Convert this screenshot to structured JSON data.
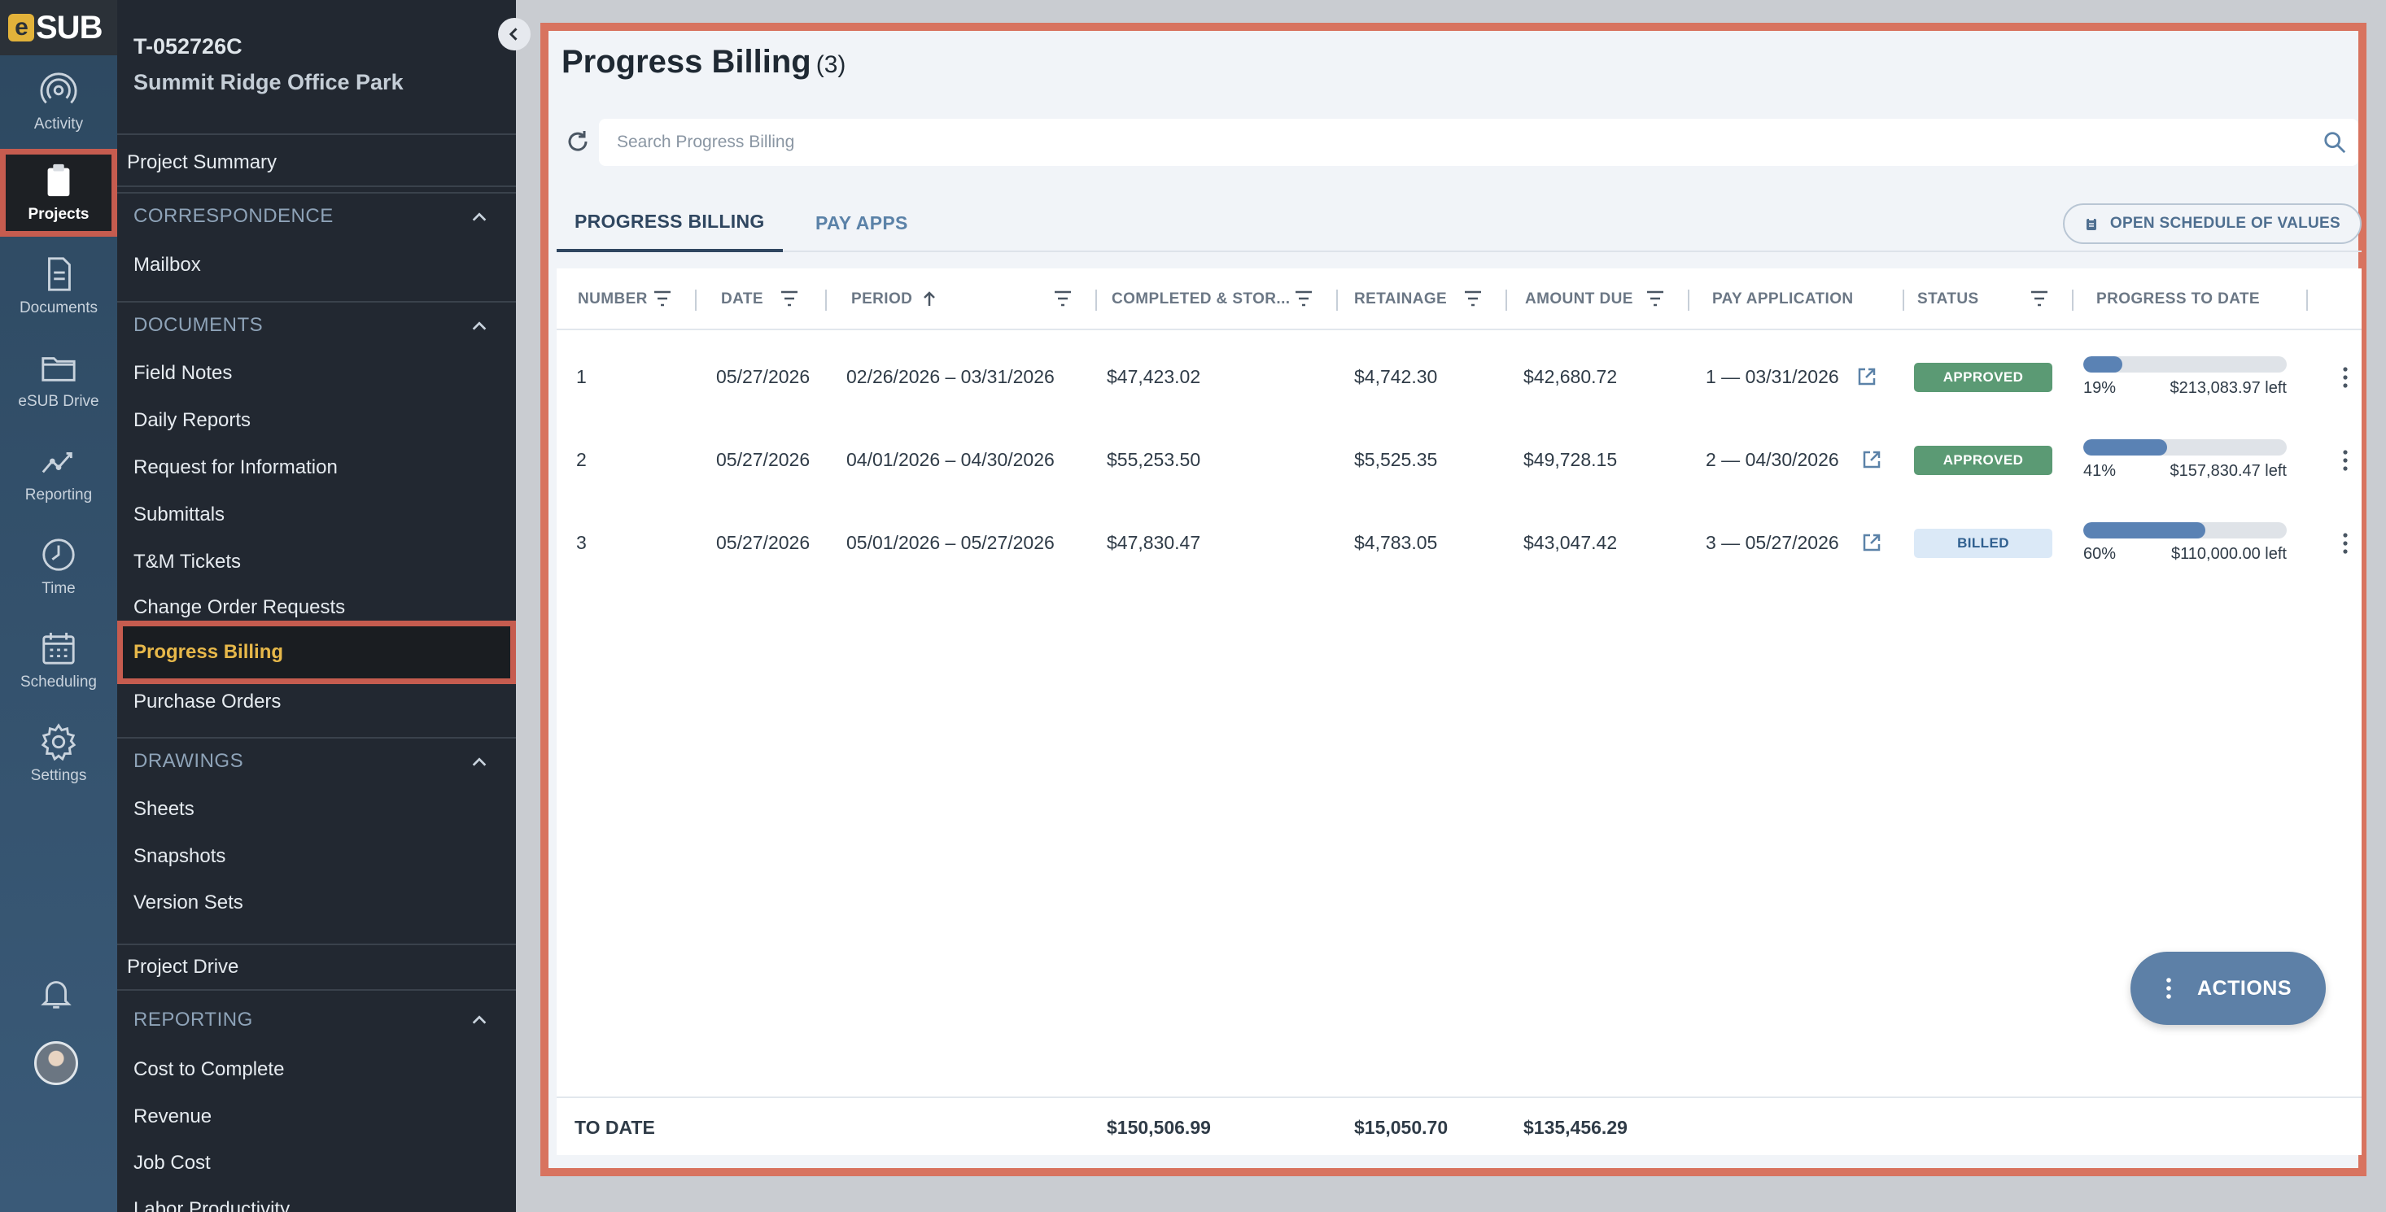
{
  "app": {
    "logo": "SUB",
    "logo_mark": "e"
  },
  "rail": {
    "items": [
      {
        "label": "Activity",
        "icon": "activity-icon"
      },
      {
        "label": "Projects",
        "icon": "clipboard-icon",
        "active": true
      },
      {
        "label": "Documents",
        "icon": "document-icon"
      },
      {
        "label": "eSUB Drive",
        "icon": "folder-icon"
      },
      {
        "label": "Reporting",
        "icon": "chart-line-icon"
      },
      {
        "label": "Time",
        "icon": "clock-icon"
      },
      {
        "label": "Scheduling",
        "icon": "calendar-icon"
      },
      {
        "label": "Settings",
        "icon": "gear-icon"
      }
    ]
  },
  "project": {
    "id": "T-052726C",
    "name": "Summit Ridge Office Park"
  },
  "nav": {
    "project_summary": "Project Summary",
    "correspondence": {
      "title": "CORRESPONDENCE",
      "items": [
        "Mailbox"
      ]
    },
    "documents": {
      "title": "DOCUMENTS",
      "items": [
        "Field Notes",
        "Daily Reports",
        "Request for Information",
        "Submittals",
        "T&M Tickets",
        "Change Order Requests",
        "Progress Billing",
        "Purchase Orders"
      ],
      "active": "Progress Billing"
    },
    "drawings": {
      "title": "DRAWINGS",
      "items": [
        "Sheets",
        "Snapshots",
        "Version Sets"
      ]
    },
    "project_drive": "Project Drive",
    "reporting": {
      "title": "REPORTING",
      "items": [
        "Cost to Complete",
        "Revenue",
        "Job Cost",
        "Labor Productivity"
      ]
    }
  },
  "main": {
    "title": "Progress Billing",
    "count": "(3)",
    "search_placeholder": "Search Progress Billing",
    "tabs": [
      "PROGRESS BILLING",
      "PAY APPS"
    ],
    "active_tab": 0,
    "sov_button": "OPEN SCHEDULE OF VALUES",
    "columns": [
      "NUMBER",
      "DATE",
      "PERIOD",
      "COMPLETED & STOR...",
      "RETAINAGE",
      "AMOUNT DUE",
      "PAY APPLICATION",
      "STATUS",
      "PROGRESS TO DATE"
    ],
    "rows": [
      {
        "number": "1",
        "date": "05/27/2026",
        "period": "02/26/2026 – 03/31/2026",
        "completed": "$47,423.02",
        "retainage": "$4,742.30",
        "amount_due": "$42,680.72",
        "pay_app": "1 — 03/31/2026",
        "status": "APPROVED",
        "progress_pct": "19%",
        "progress_value": 0.19,
        "left": "$213,083.97 left"
      },
      {
        "number": "2",
        "date": "05/27/2026",
        "period": "04/01/2026 – 04/30/2026",
        "completed": "$55,253.50",
        "retainage": "$5,525.35",
        "amount_due": "$49,728.15",
        "pay_app": "2 — 04/30/2026",
        "status": "APPROVED",
        "progress_pct": "41%",
        "progress_value": 0.41,
        "left": "$157,830.47 left"
      },
      {
        "number": "3",
        "date": "05/27/2026",
        "period": "05/01/2026 – 05/27/2026",
        "completed": "$47,830.47",
        "retainage": "$4,783.05",
        "amount_due": "$43,047.42",
        "pay_app": "3 — 05/27/2026",
        "status": "BILLED",
        "progress_pct": "60%",
        "progress_value": 0.6,
        "left": "$110,000.00 left"
      }
    ],
    "footer": {
      "label": "TO DATE",
      "completed": "$150,506.99",
      "retainage": "$15,050.70",
      "amount_due": "$135,456.29"
    },
    "actions_button": "ACTIONS"
  },
  "colors": {
    "accent_highlight": "#c65c4f",
    "nav_active_text": "#e7b84a",
    "status_approved": "#5b9a74",
    "status_billed_bg": "#dbe9f7",
    "progress_fill": "#5a82b4"
  }
}
